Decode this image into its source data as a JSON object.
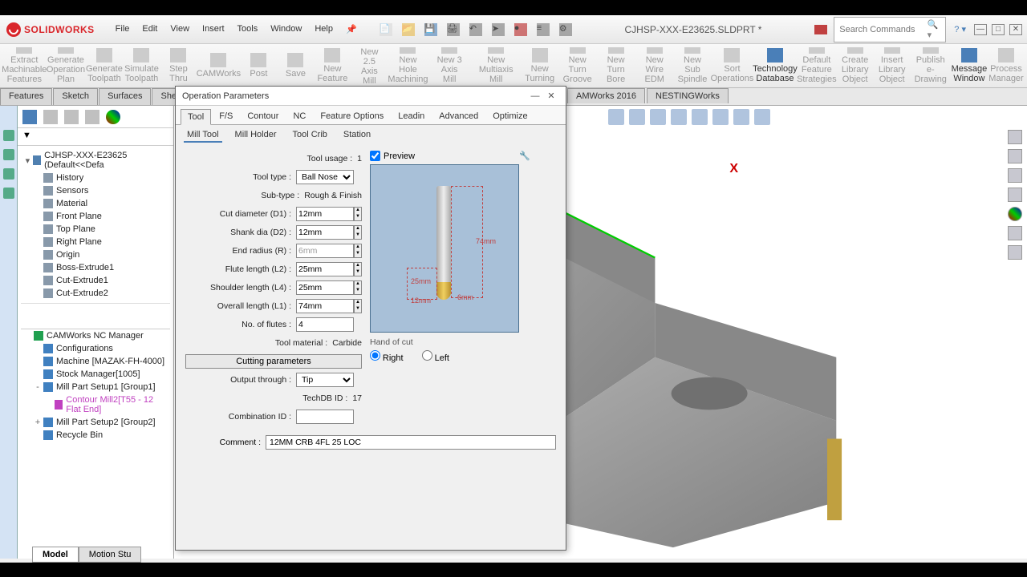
{
  "app": {
    "logo_text": "SOLIDWORKS",
    "doc_title": "CJHSP-XXX-E23625.SLDPRT *",
    "search_placeholder": "Search Commands"
  },
  "menu": [
    "File",
    "Edit",
    "View",
    "Insert",
    "Tools",
    "Window",
    "Help"
  ],
  "ribbon": [
    {
      "l1": "Extract",
      "l2": "Machinable",
      "l3": "Features"
    },
    {
      "l1": "Generate",
      "l2": "Operation",
      "l3": "Plan"
    },
    {
      "l1": "Generate",
      "l2": "Toolpath",
      "l3": ""
    },
    {
      "l1": "Simulate",
      "l2": "Toolpath",
      "l3": ""
    },
    {
      "l1": "Step",
      "l2": "Thru",
      "l3": ""
    },
    {
      "l1": "CAMWorks",
      "l2": "",
      "l3": ""
    },
    {
      "l1": "Post",
      "l2": "",
      "l3": ""
    },
    {
      "l1": "Save",
      "l2": "",
      "l3": ""
    },
    {
      "l1": "New",
      "l2": "Feature",
      "l3": ""
    },
    {
      "l1": "New 2.5",
      "l2": "Axis Mill",
      "l3": ""
    },
    {
      "l1": "New Hole",
      "l2": "Machining",
      "l3": ""
    },
    {
      "l1": "New 3 Axis",
      "l2": "Mill",
      "l3": ""
    },
    {
      "l1": "New Multiaxis",
      "l2": "Mill",
      "l3": ""
    },
    {
      "l1": "New",
      "l2": "Turning",
      "l3": ""
    },
    {
      "l1": "New Turn",
      "l2": "Groove",
      "l3": ""
    },
    {
      "l1": "New Turn",
      "l2": "Bore",
      "l3": ""
    },
    {
      "l1": "New Wire",
      "l2": "EDM",
      "l3": ""
    },
    {
      "l1": "New Sub",
      "l2": "Spindle",
      "l3": ""
    },
    {
      "l1": "Sort",
      "l2": "Operations",
      "l3": ""
    },
    {
      "l1": "Technology",
      "l2": "Database",
      "l3": "",
      "active": true
    },
    {
      "l1": "Default",
      "l2": "Feature",
      "l3": "Strategies"
    },
    {
      "l1": "Create",
      "l2": "Library",
      "l3": "Object"
    },
    {
      "l1": "Insert",
      "l2": "Library",
      "l3": "Object"
    },
    {
      "l1": "Publish",
      "l2": "e-Drawing",
      "l3": ""
    },
    {
      "l1": "Message",
      "l2": "Window",
      "l3": "",
      "active": true
    },
    {
      "l1": "Process",
      "l2": "Manager",
      "l3": ""
    }
  ],
  "tabs": [
    "Features",
    "Sketch",
    "Surfaces",
    "Sheet Metal"
  ],
  "extra_tabs": [
    "AMWorks 2016",
    "NESTINGWorks"
  ],
  "fm_tree1": {
    "root": "CJHSP-XXX-E23625  (Default<<Defa",
    "items": [
      "History",
      "Sensors",
      "Material <not specified>",
      "Front Plane",
      "Top Plane",
      "Right Plane",
      "Origin",
      "Boss-Extrude1",
      "Cut-Extrude1",
      "Cut-Extrude2"
    ]
  },
  "fm_tree2": {
    "root": "CAMWorks NC Manager",
    "items": [
      {
        "t": "Configurations",
        "lvl": 1
      },
      {
        "t": "Machine [MAZAK-FH-4000]",
        "lvl": 1
      },
      {
        "t": "Stock Manager[1005]",
        "lvl": 1
      },
      {
        "t": "Mill Part Setup1 [Group1]",
        "lvl": 1,
        "exp": "-"
      },
      {
        "t": "Contour Mill2[T55 - 12 Flat End]",
        "lvl": 2,
        "sel": true
      },
      {
        "t": "Mill Part Setup2 [Group2]",
        "lvl": 1,
        "exp": "+"
      },
      {
        "t": "Recycle Bin",
        "lvl": 1
      }
    ]
  },
  "bottom_tabs": [
    "Model",
    "Motion Stu"
  ],
  "dialog": {
    "title": "Operation Parameters",
    "tabs": [
      "Tool",
      "F/S",
      "Contour",
      "NC",
      "Feature Options",
      "Leadin",
      "Advanced",
      "Optimize"
    ],
    "subtabs": [
      "Mill Tool",
      "Mill Holder",
      "Tool Crib",
      "Station"
    ],
    "tool_usage_label": "Tool usage :",
    "tool_usage_value": "1",
    "tool_type_label": "Tool type :",
    "tool_type_value": "Ball Nose",
    "sub_type_label": "Sub-type :",
    "sub_type_value": "Rough & Finish",
    "cut_dia_label": "Cut diameter (D1) :",
    "cut_dia_value": "12mm",
    "shank_dia_label": "Shank dia (D2) :",
    "shank_dia_value": "12mm",
    "end_radius_label": "End radius (R) :",
    "end_radius_value": "6mm",
    "flute_len_label": "Flute length (L2) :",
    "flute_len_value": "25mm",
    "shoulder_len_label": "Shoulder length (L4) :",
    "shoulder_len_value": "25mm",
    "overall_len_label": "Overall length (L1) :",
    "overall_len_value": "74mm",
    "no_flutes_label": "No. of flutes :",
    "no_flutes_value": "4",
    "tool_mat_label": "Tool material :",
    "tool_mat_value": "Carbide",
    "cutting_params_btn": "Cutting parameters",
    "output_through_label": "Output through :",
    "output_through_value": "Tip",
    "techdb_label": "TechDB ID :",
    "techdb_value": "17",
    "combination_label": "Combination ID :",
    "combination_value": "",
    "comment_label": "Comment :",
    "comment_value": "12MM CRB 4FL 25 LOC",
    "preview_label": "Preview",
    "preview_dims": {
      "d1": "12mm",
      "l2": "25mm",
      "l1": "74mm",
      "r": "6mm"
    },
    "hand_title": "Hand of cut",
    "hand_right": "Right",
    "hand_left": "Left"
  },
  "axis_x": "X"
}
